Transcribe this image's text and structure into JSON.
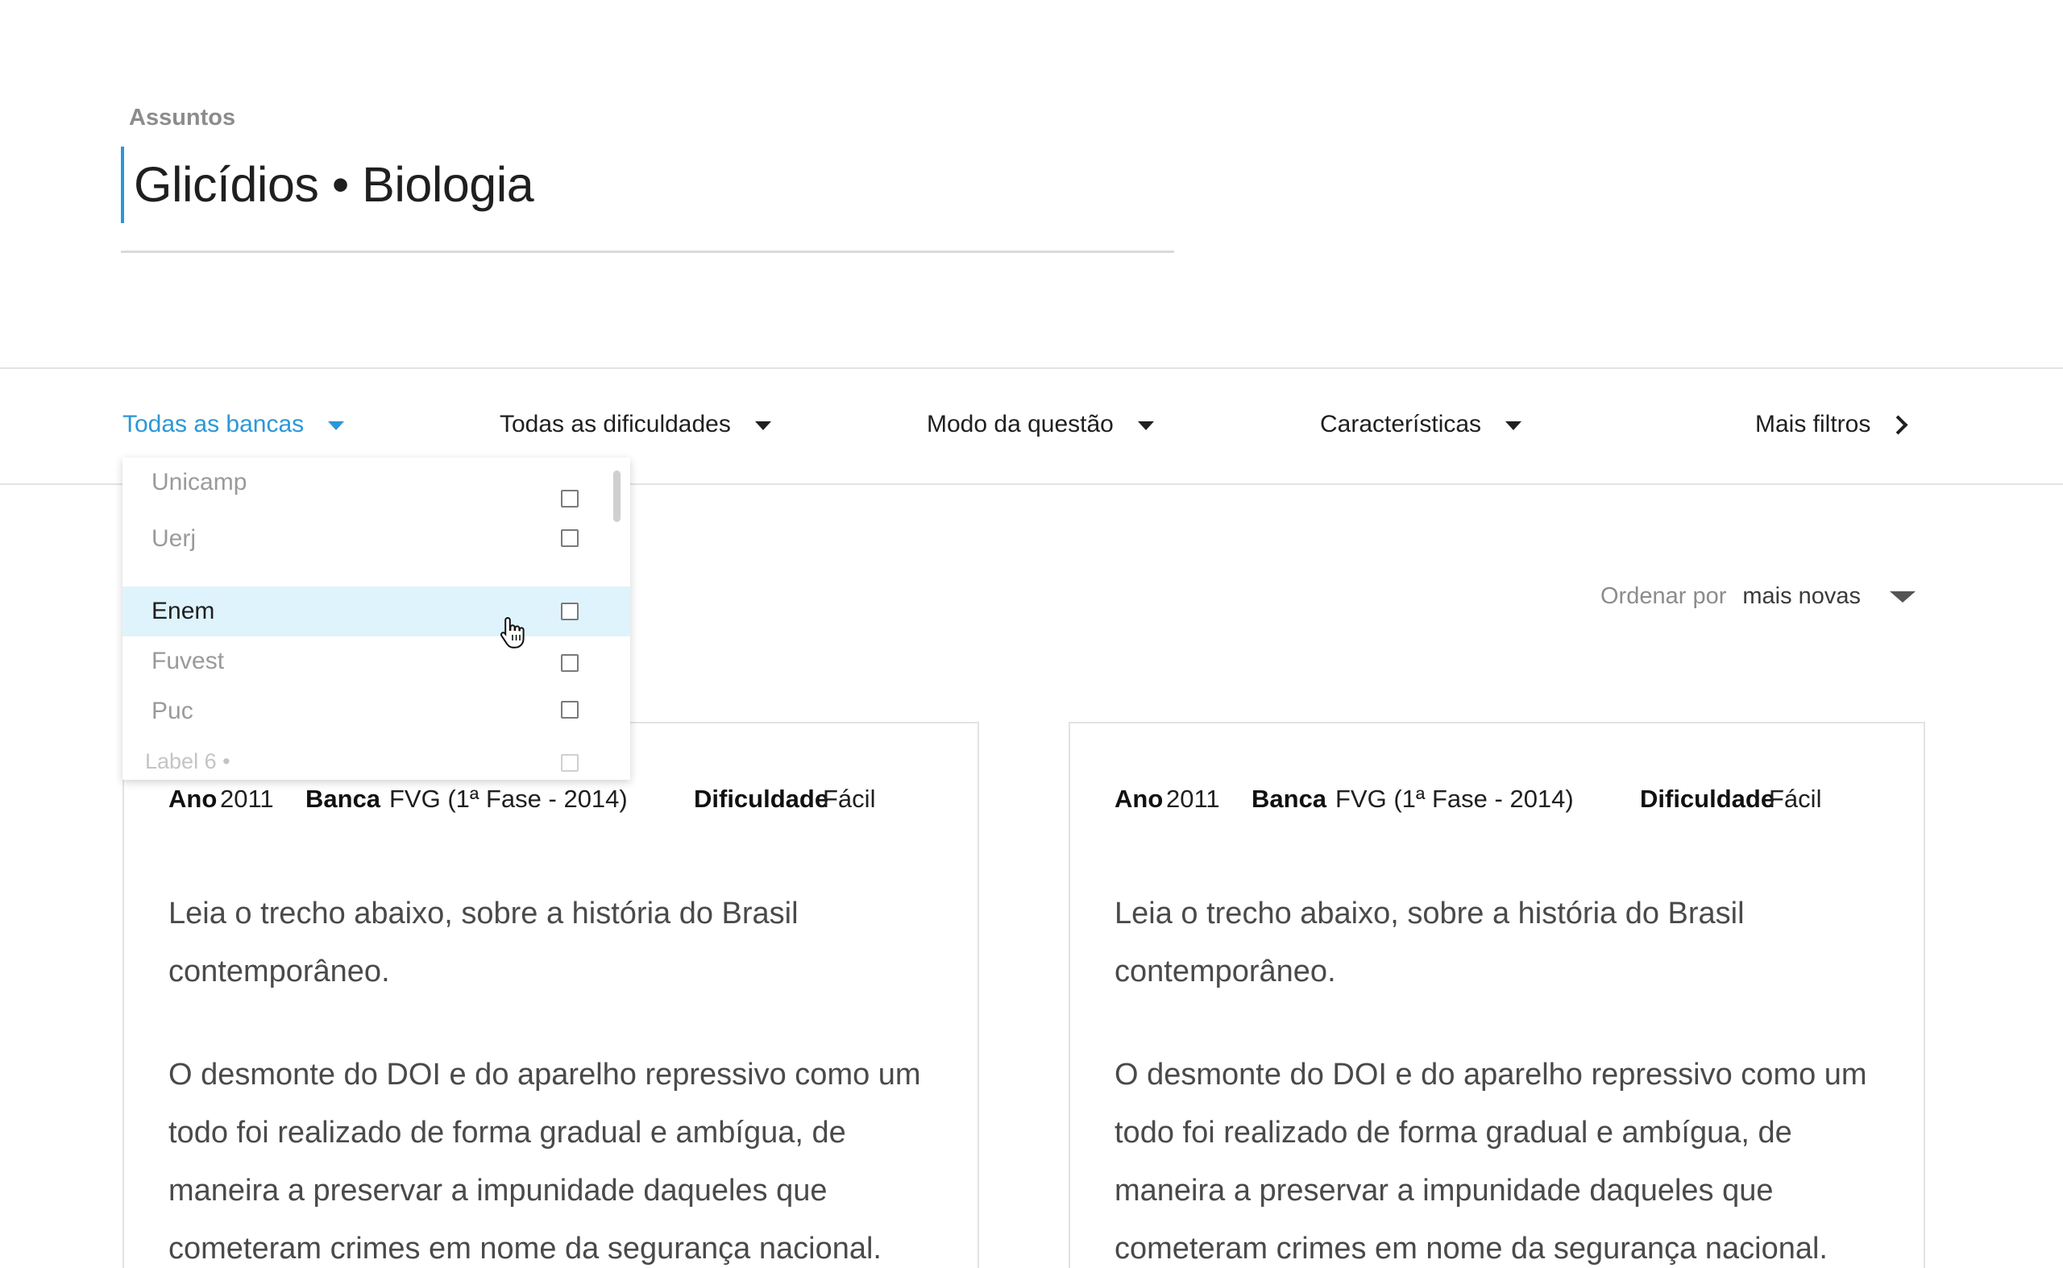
{
  "header": {
    "breadcrumb": "Assuntos",
    "title": "Glicídios • Biologia"
  },
  "filters": {
    "bancas": "Todas as bancas",
    "dificuldades": "Todas as dificuldades",
    "modo": "Modo da questão",
    "caracteristicas": "Características",
    "mais_filtros": "Mais filtros"
  },
  "sort": {
    "label": "Ordenar por",
    "value": "mais novas"
  },
  "dropdown": {
    "items": [
      {
        "label": "Unicamp",
        "checked": false
      },
      {
        "label": "Uerj",
        "checked": false
      },
      {
        "label": "Enem",
        "checked": false,
        "hovered": true
      },
      {
        "label": "Fuvest",
        "checked": false
      },
      {
        "label": "Puc",
        "checked": false
      },
      {
        "label": "Label 6 •",
        "checked": false
      }
    ]
  },
  "cards": [
    {
      "ano_label": "Ano",
      "ano": "2011",
      "banca_label": "Banca",
      "banca": "FVG (1ª Fase - 2014)",
      "dificuldade_label": "Dificuldade",
      "dificuldade": "Fácil",
      "paragraph1": "Leia o trecho abaixo, sobre a história do Brasil contemporâneo.",
      "paragraph2": "O desmonte do DOI e do aparelho repressivo como um todo foi realizado de forma gradual e ambígua, de maneira a preservar a impunidade daqueles que cometeram crimes em nome da segurança nacional."
    },
    {
      "ano_label": "Ano",
      "ano": "2011",
      "banca_label": "Banca",
      "banca": "FVG (1ª Fase - 2014)",
      "dificuldade_label": "Dificuldade",
      "dificuldade": "Fácil",
      "paragraph1": "Leia o trecho abaixo, sobre a história do Brasil contemporâneo.",
      "paragraph2": "O desmonte do DOI e do aparelho repressivo como um todo foi realizado de forma gradual e ambígua, de maneira a preservar a impunidade daqueles que cometeram crimes em nome da segurança nacional."
    }
  ],
  "colors": {
    "accent": "#2b97d6",
    "hover_row": "#dff3fc",
    "border": "#e3e3e3"
  }
}
